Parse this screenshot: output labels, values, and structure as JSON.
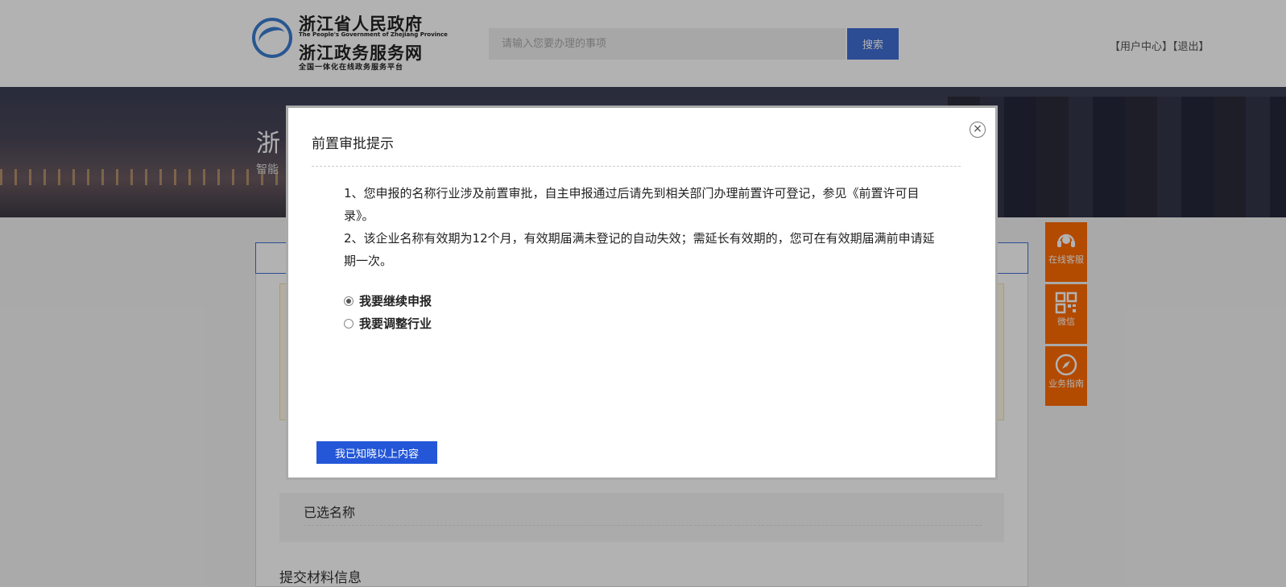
{
  "header": {
    "logo_title_1": "浙江省人民政府",
    "logo_en": "The People's Government of Zhejiang Province",
    "logo_title_2": "浙江政务服务网",
    "logo_sub": "全国一体化在线政务服务平台",
    "search_placeholder": "请输入您要办理的事项",
    "search_button": "搜索",
    "user_center": "【用户中心】",
    "logout": "【退出】"
  },
  "banner": {
    "title_visible": "浙",
    "sub_visible": "智能"
  },
  "content": {
    "selected_name_label": "已选名称",
    "submit_materials_title": "提交材料信息"
  },
  "side": {
    "items": [
      {
        "icon": "headset-icon",
        "label": "在线客服"
      },
      {
        "icon": "qrcode-icon",
        "label": "微信"
      },
      {
        "icon": "compass-icon",
        "label": "业务指南"
      }
    ]
  },
  "modal": {
    "title": "前置审批提示",
    "close": "×",
    "paragraph_1": "1、您申报的名称行业涉及前置审批，自主申报通过后请先到相关部门办理前置许可登记，参见《前置许可目录》。",
    "paragraph_2": "2、该企业名称有效期为12个月，有效期届满未登记的自动失效；需延长有效期的，您可在有效期届满前申请延期一次。",
    "options": [
      {
        "label": "我要继续申报",
        "checked": true
      },
      {
        "label": "我要调整行业",
        "checked": false
      }
    ],
    "confirm_button": "我已知晓以上内容"
  },
  "colors": {
    "accent": "#3f6fd4",
    "side_orange": "#ff6a00",
    "confirm_blue": "#2457d8"
  }
}
